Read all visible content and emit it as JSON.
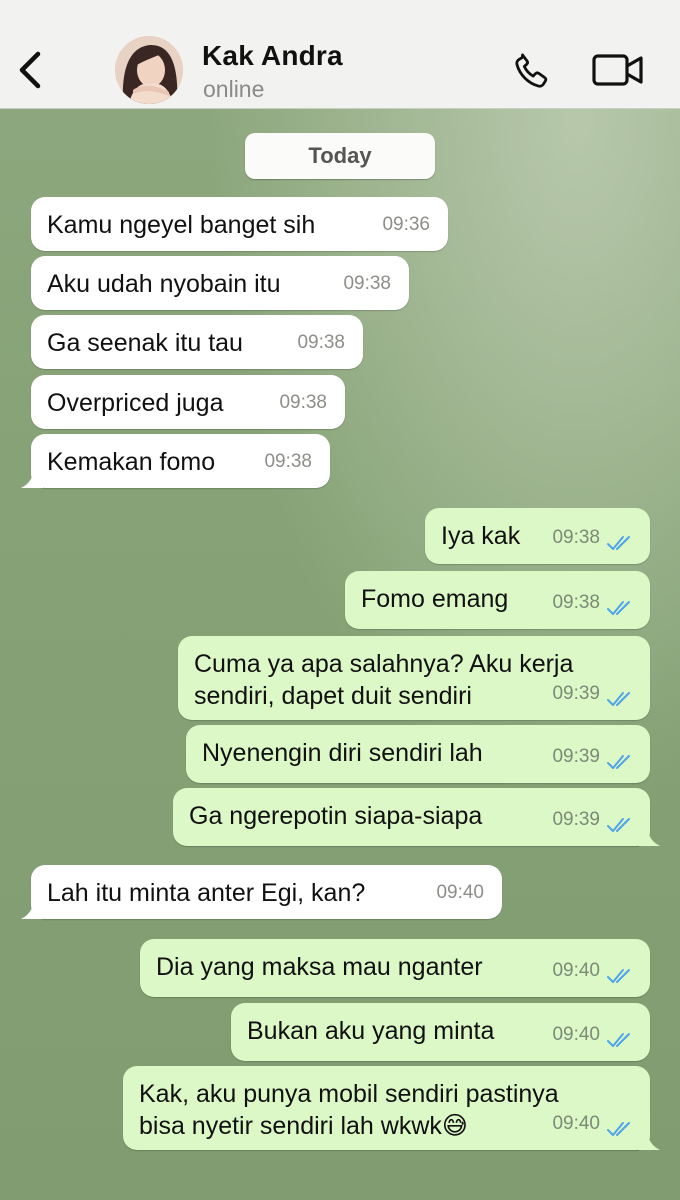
{
  "header": {
    "contact_name": "Kak Andra",
    "status": "online",
    "back_icon": "chevron-left-icon",
    "call_icon": "phone-icon",
    "video_icon": "video-camera-icon"
  },
  "date_chip": "Today",
  "colors": {
    "incoming_bubble": "#ffffff",
    "outgoing_bubble": "#dcf8c6",
    "read_tick": "#4fa3e8",
    "chat_background": "#86a276"
  },
  "messages": [
    {
      "dir": "in",
      "lines": [
        "Kamu ngeyel banget sih"
      ],
      "time": "09:36"
    },
    {
      "dir": "in",
      "lines": [
        "Aku udah nyobain itu"
      ],
      "time": "09:38"
    },
    {
      "dir": "in",
      "lines": [
        "Ga seenak itu tau"
      ],
      "time": "09:38"
    },
    {
      "dir": "in",
      "lines": [
        "Overpriced juga"
      ],
      "time": "09:38"
    },
    {
      "dir": "in",
      "lines": [
        "Kemakan fomo"
      ],
      "time": "09:38"
    },
    {
      "dir": "out",
      "lines": [
        "Iya kak"
      ],
      "time": "09:38",
      "read": true
    },
    {
      "dir": "out",
      "lines": [
        "Fomo emang"
      ],
      "time": "09:38",
      "read": true
    },
    {
      "dir": "out",
      "lines": [
        "Cuma ya apa salahnya? Aku kerja",
        "sendiri, dapet duit sendiri"
      ],
      "time": "09:39",
      "read": true
    },
    {
      "dir": "out",
      "lines": [
        "Nyenengin diri sendiri lah"
      ],
      "time": "09:39",
      "read": true
    },
    {
      "dir": "out",
      "lines": [
        "Ga ngerepotin siapa-siapa"
      ],
      "time": "09:39",
      "read": true
    },
    {
      "dir": "in",
      "lines": [
        "Lah itu minta anter Egi, kan?"
      ],
      "time": "09:40"
    },
    {
      "dir": "out",
      "lines": [
        "Dia yang maksa mau nganter"
      ],
      "time": "09:40",
      "read": true
    },
    {
      "dir": "out",
      "lines": [
        "Bukan aku yang minta"
      ],
      "time": "09:40",
      "read": true
    },
    {
      "dir": "out",
      "lines": [
        "Kak, aku punya mobil sendiri pastinya",
        "bisa nyetir sendiri lah wkwk😅"
      ],
      "time": "09:40",
      "read": true
    }
  ]
}
